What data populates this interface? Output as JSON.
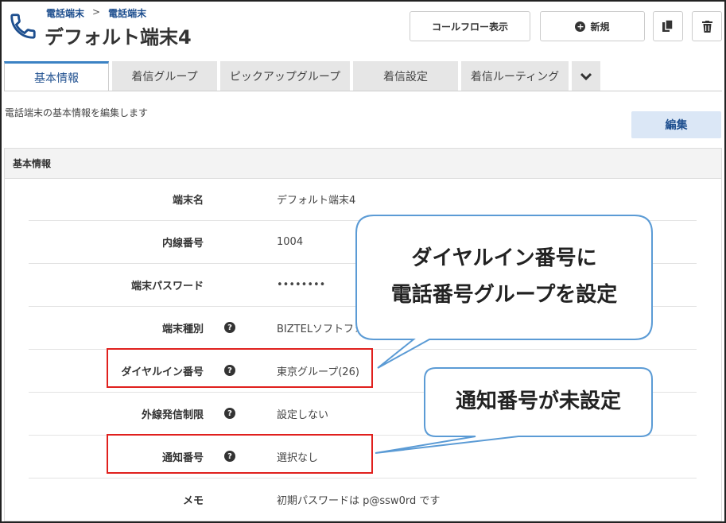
{
  "header": {
    "breadcrumb_parent": "電話端末",
    "breadcrumb_sep": ">",
    "breadcrumb_current": "電話端末",
    "title": "デフォルト端末4",
    "callflow_button": "コールフロー表示",
    "new_button": "新規",
    "new_icon": "+"
  },
  "tabs": [
    {
      "label": "基本情報",
      "active": true
    },
    {
      "label": "着信グループ"
    },
    {
      "label": "ピックアップグループ"
    },
    {
      "label": "着信設定"
    },
    {
      "label": "着信ルーティング"
    }
  ],
  "tab_more_icon": "chevron-down-icon",
  "description": "電話端末の基本情報を編集します",
  "edit_button": "編集",
  "panel": {
    "title": "基本情報",
    "rows": [
      {
        "label": "端末名",
        "value": "デフォルト端末4"
      },
      {
        "label": "内線番号",
        "value": "1004"
      },
      {
        "label": "端末パスワード",
        "value": "••••••••"
      },
      {
        "label": "端末種別",
        "value": "BIZTELソフトフォン",
        "help": true
      },
      {
        "label": "ダイヤルイン番号",
        "value": "東京グループ(26)",
        "help": true
      },
      {
        "label": "外線発信制限",
        "value": "設定しない",
        "help": true
      },
      {
        "label": "通知番号",
        "value": "選択なし",
        "help": true
      },
      {
        "label": "メモ",
        "value": "初期パスワードは p@ssw0rd です"
      }
    ],
    "help_glyph": "?"
  },
  "callouts": {
    "dialin_line1": "ダイヤルイン番号に",
    "dialin_line2": "電話番号グループを設定",
    "notify": "通知番号が未設定"
  },
  "colors": {
    "accent": "#1e4f8f",
    "highlight": "#e0201d",
    "callout_border": "#5b9bd5"
  }
}
